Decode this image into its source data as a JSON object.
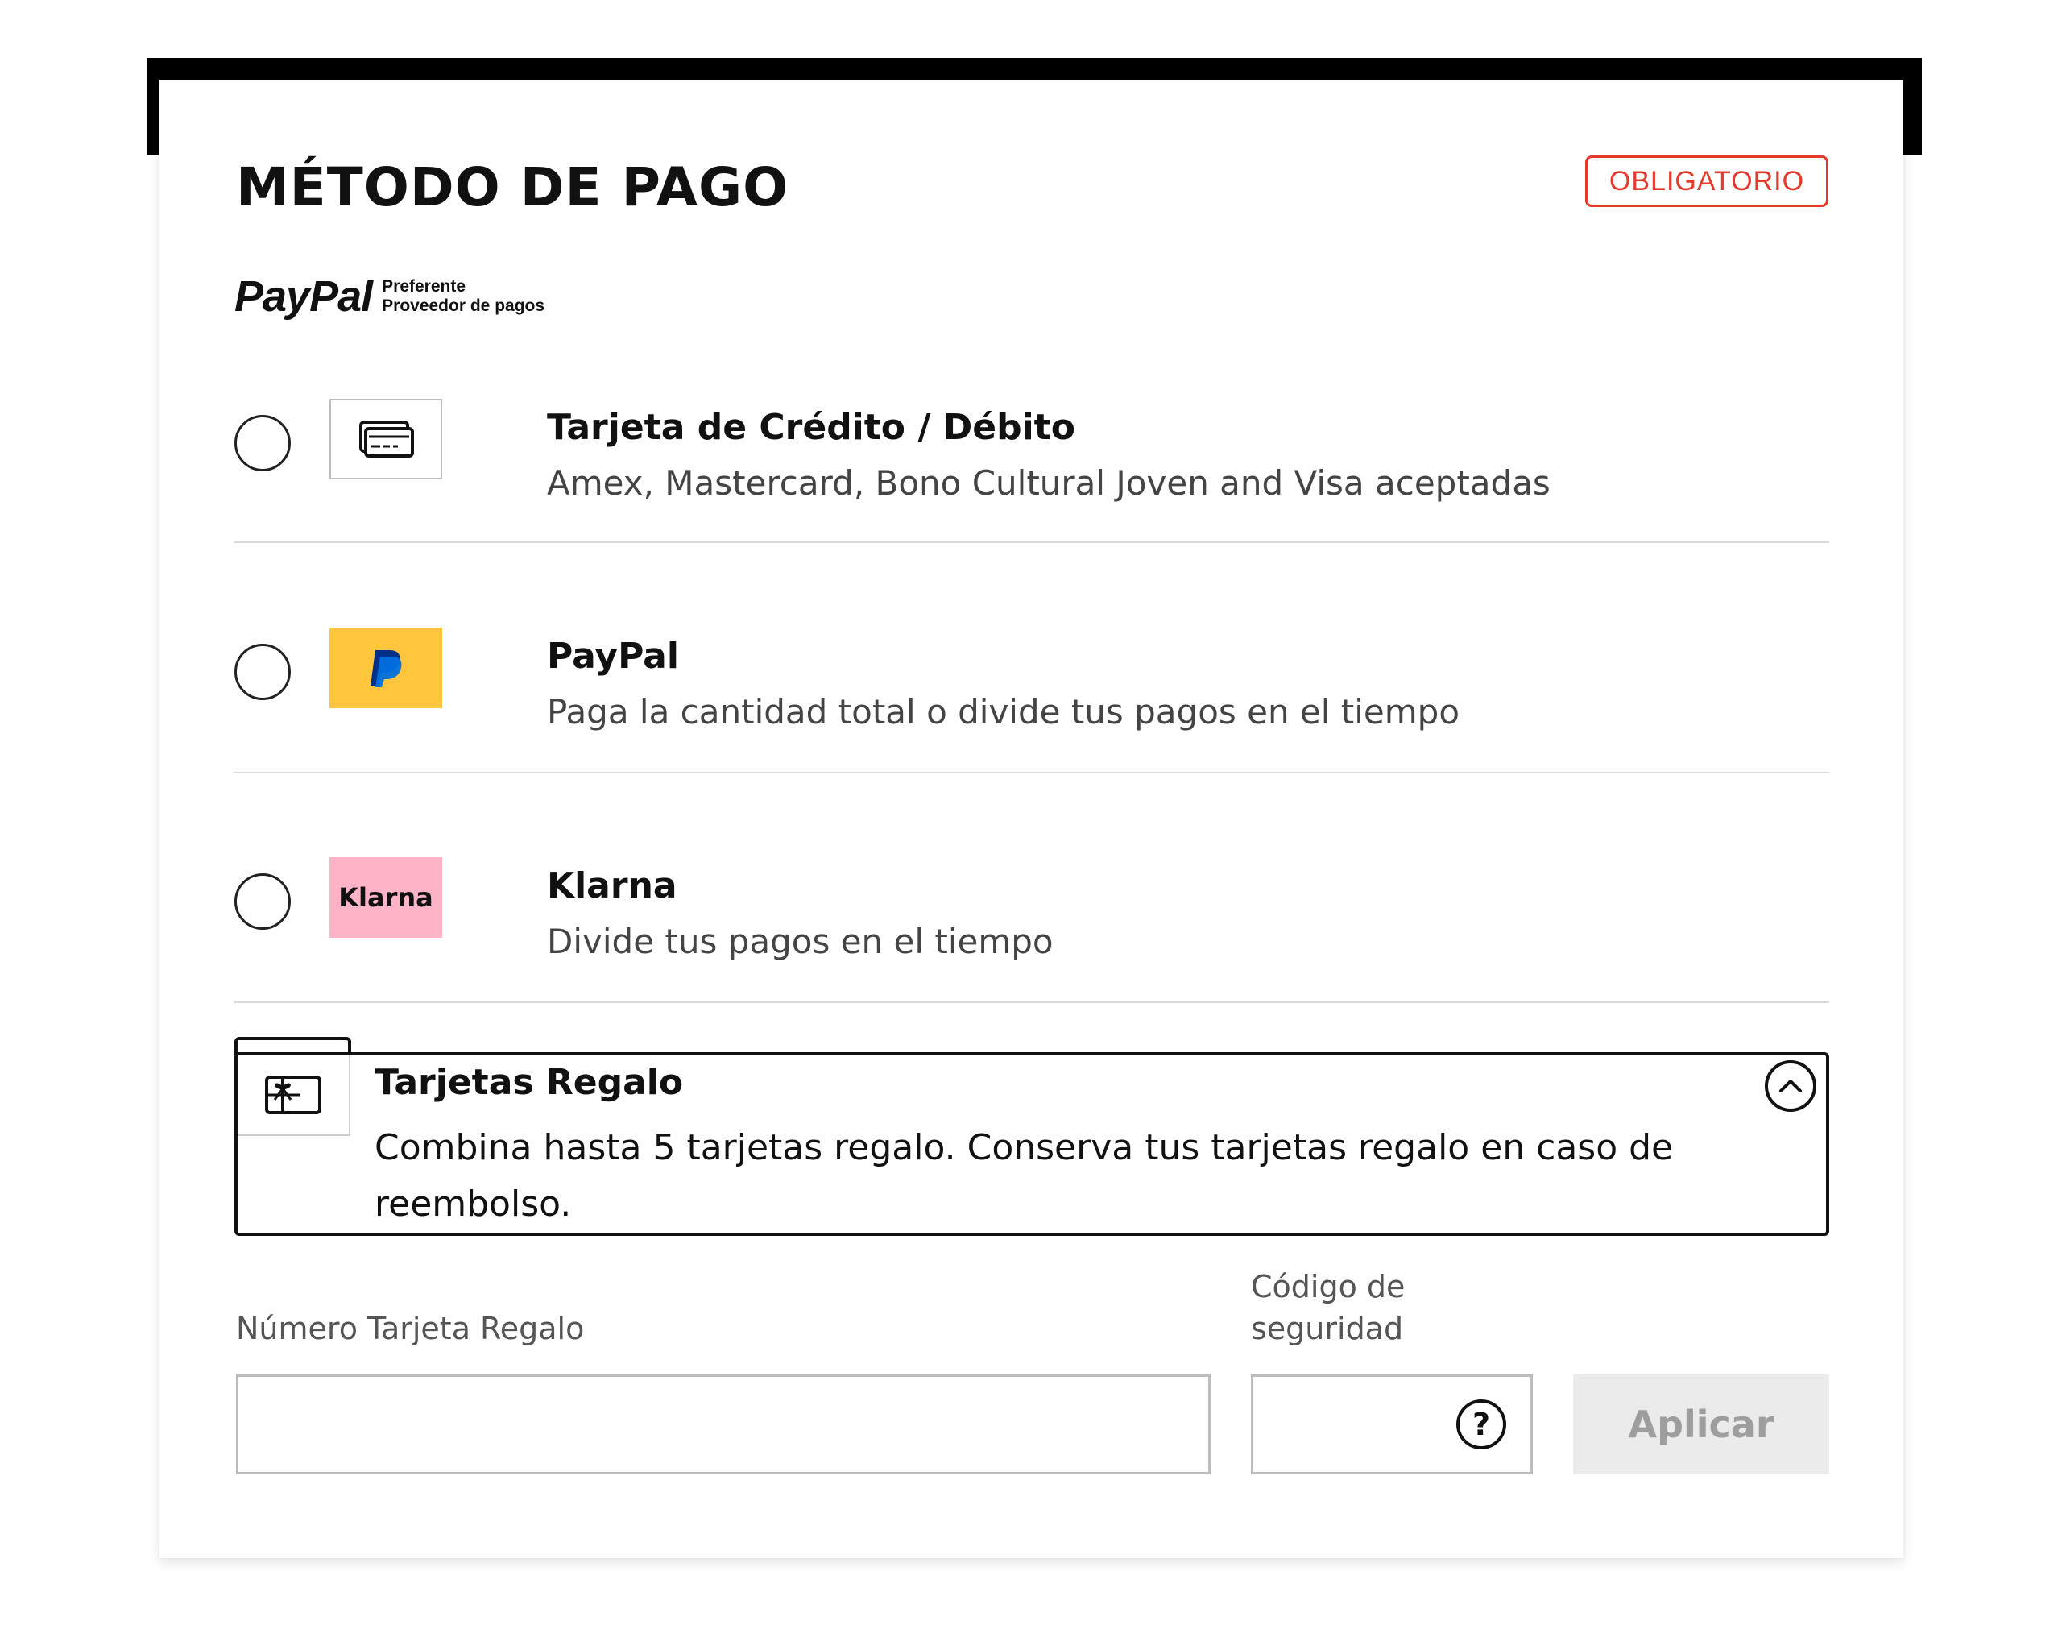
{
  "header": {
    "title": "MÉTODO DE PAGO",
    "required_badge": "OBLIGATORIO"
  },
  "paypal_preferred": {
    "brand": "PayPal",
    "line1": "Preferente",
    "line2": "Proveedor de pagos"
  },
  "payment_options": [
    {
      "title": "Tarjeta de Crédito / Débito",
      "subtitle": "Amex, Mastercard, Bono Cultural Joven and Visa aceptadas",
      "icon": "credit-card-icon"
    },
    {
      "title": "PayPal",
      "subtitle": "Paga la cantidad total o divide tus pagos en el tiempo",
      "icon": "paypal-icon"
    },
    {
      "title": "Klarna",
      "subtitle": "Divide tus pagos en el tiempo",
      "icon": "klarna-icon",
      "logo_text": "Klarna"
    }
  ],
  "gift_cards": {
    "title": "Tarjetas Regalo",
    "description": "Combina hasta 5 tarjetas regalo. Conserva tus tarjetas regalo en caso de reembolso.",
    "number_label": "Número Tarjeta Regalo",
    "number_value": "",
    "security_label_line1": "Código de",
    "security_label_line2": "seguridad",
    "security_value": "",
    "help_symbol": "?",
    "apply_label": "Aplicar"
  },
  "colors": {
    "required_red": "#e5392e",
    "paypal_yellow": "#ffc53d",
    "klarna_pink": "#ffb3c7",
    "disabled_button": "#ebebeb"
  }
}
